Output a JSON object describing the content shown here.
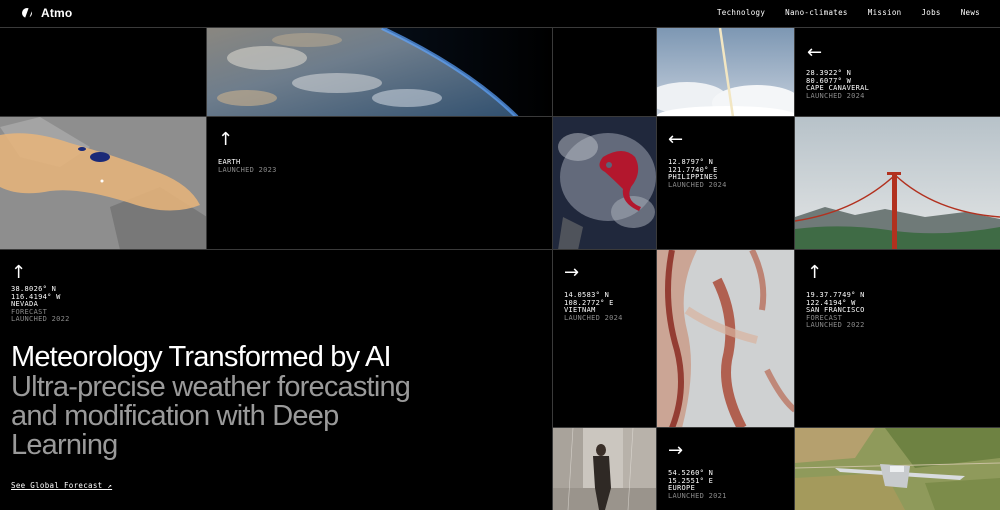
{
  "brand": {
    "name": "Atmo"
  },
  "nav": [
    "Technology",
    "Nano-climates",
    "Mission",
    "Jobs",
    "News"
  ],
  "tiles": {
    "cape_canaveral": {
      "arrow": "←",
      "coords": [
        "28.3922° N",
        "80.6077° W",
        "CAPE CANAVERAL"
      ],
      "sub": [
        "LAUNCHED 2024"
      ]
    },
    "earth": {
      "arrow": "↑",
      "coords": [
        "EARTH"
      ],
      "sub": [
        "LAUNCHED 2023"
      ]
    },
    "philippines": {
      "arrow": "←",
      "coords": [
        "12.8797° N",
        "121.7740° E",
        "PHILIPPINES"
      ],
      "sub": [
        "LAUNCHED 2024"
      ]
    },
    "nevada": {
      "arrow": "↑",
      "coords": [
        "38.8026° N",
        "116.4194° W",
        "NEVADA"
      ],
      "sub": [
        "FORECAST",
        "LAUNCHED 2022"
      ]
    },
    "vietnam": {
      "arrow": "→",
      "coords": [
        "14.0583° N",
        "108.2772° E",
        "VIETNAM"
      ],
      "sub": [
        "LAUNCHED 2024"
      ]
    },
    "san_francisco": {
      "arrow": "↑",
      "coords": [
        "19.37.7749° N",
        "122.4194° W",
        "SAN FRANCISCO"
      ],
      "sub": [
        "FORECAST",
        "LAUNCHED 2022"
      ]
    },
    "europe": {
      "arrow": "→",
      "coords": [
        "54.5260° N",
        "15.2551° E",
        "EUROPE"
      ],
      "sub": [
        "LAUNCHED 2021"
      ]
    }
  },
  "hero": {
    "title": "Meteorology Transformed by AI",
    "subtitle": "Ultra-precise weather forecasting and modification with Deep Learning",
    "cta": "See Global Forecast ↗"
  }
}
